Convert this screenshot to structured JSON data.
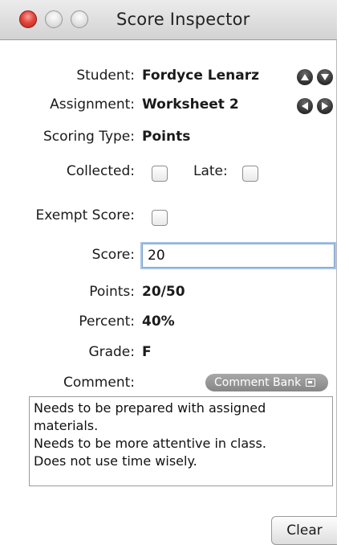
{
  "window": {
    "title": "Score Inspector"
  },
  "fields": {
    "student": {
      "label": "Student:",
      "value": "Fordyce Lenarz"
    },
    "assignment": {
      "label": "Assignment:",
      "value": "Worksheet 2"
    },
    "scoring_type": {
      "label": "Scoring Type:",
      "value": "Points"
    },
    "collected": {
      "label": "Collected:",
      "checked": false
    },
    "late": {
      "label": "Late:",
      "checked": false
    },
    "exempt": {
      "label": "Exempt Score:",
      "checked": false
    },
    "score": {
      "label": "Score:",
      "value": "20"
    },
    "points": {
      "label": "Points:",
      "value": "20/50"
    },
    "percent": {
      "label": "Percent:",
      "value": "40%"
    },
    "grade": {
      "label": "Grade:",
      "value": "F"
    }
  },
  "comment": {
    "label": "Comment:",
    "bank_button": "Comment Bank",
    "lines": [
      "Needs to be prepared with assigned",
      "materials.",
      "Needs to be more attentive in class.",
      "Does not use time wisely."
    ]
  },
  "buttons": {
    "clear": "Clear"
  },
  "icons": {
    "student_nav": [
      "arrow-up-icon",
      "arrow-down-icon"
    ],
    "assignment_nav": [
      "arrow-left-icon",
      "arrow-right-icon"
    ]
  },
  "colors": {
    "close_button": "#e4473c",
    "focus_ring": "#a7c4e9",
    "comment_bank_bg": "#969696"
  }
}
